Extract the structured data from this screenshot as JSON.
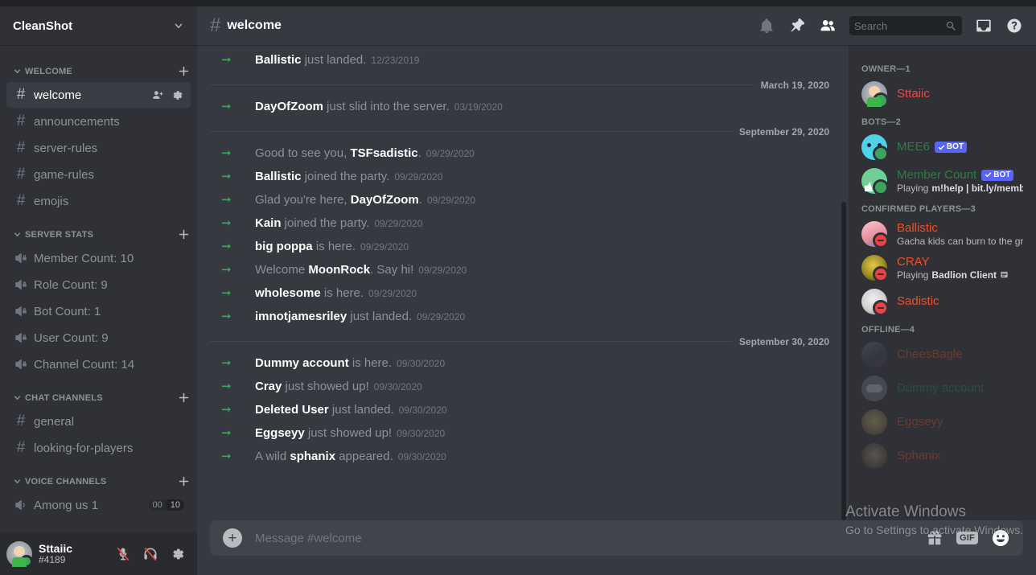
{
  "server": {
    "name": "CleanShot",
    "chevron_icon": "chevron-down-icon"
  },
  "sidebar": {
    "categories": [
      {
        "label": "WELCOME",
        "channels": [
          {
            "name": "welcome",
            "type": "text",
            "active": true,
            "actions": [
              "person-add-icon",
              "gear-icon"
            ]
          },
          {
            "name": "announcements",
            "type": "text",
            "active": false
          },
          {
            "name": "server-rules",
            "type": "text",
            "active": false
          },
          {
            "name": "game-rules",
            "type": "text",
            "active": false
          },
          {
            "name": "emojis",
            "type": "text",
            "active": false
          }
        ]
      },
      {
        "label": "SERVER STATS",
        "channels": [
          {
            "name": "Member Count: 10",
            "type": "voice-locked",
            "active": false
          },
          {
            "name": "Role Count: 9",
            "type": "voice-locked",
            "active": false
          },
          {
            "name": "Bot Count: 1",
            "type": "voice-locked",
            "active": false
          },
          {
            "name": "User Count: 9",
            "type": "voice-locked",
            "active": false
          },
          {
            "name": "Channel Count: 14",
            "type": "voice-locked",
            "active": false
          }
        ]
      },
      {
        "label": "CHAT CHANNELS",
        "channels": [
          {
            "name": "general",
            "type": "text",
            "active": false
          },
          {
            "name": "looking-for-players",
            "type": "text",
            "active": false
          }
        ]
      },
      {
        "label": "VOICE CHANNELS",
        "channels": [
          {
            "name": "Among us 1",
            "type": "voice",
            "active": false,
            "limit_current": "00",
            "limit_max": "10"
          }
        ]
      }
    ],
    "add_channel_icon": "plus-icon",
    "collapse_icon": "chevron-down-icon"
  },
  "user_panel": {
    "name": "Sttaiic",
    "tag": "#4189",
    "avatar": "av-sttaiic",
    "buttons": [
      {
        "name": "mute-button",
        "icon": "microphone-muted-icon"
      },
      {
        "name": "deafen-button",
        "icon": "headphones-deafened-icon"
      },
      {
        "name": "user-settings-button",
        "icon": "gear-icon"
      }
    ]
  },
  "header": {
    "channel_name": "welcome",
    "hash_icon": "hash-icon",
    "icons": [
      {
        "name": "notifications-button",
        "icon": "bell-icon"
      },
      {
        "name": "pinned-messages-button",
        "icon": "pin-icon"
      },
      {
        "name": "member-list-button",
        "icon": "members-icon"
      }
    ],
    "right_icons": [
      {
        "name": "inbox-button",
        "icon": "inbox-icon"
      },
      {
        "name": "help-button",
        "icon": "help-circle-icon"
      }
    ]
  },
  "search": {
    "placeholder": "Search",
    "value": "",
    "icon": "search-icon"
  },
  "messages": [
    {
      "kind": "system",
      "prefix": "",
      "user": "Ballistic",
      "suffix": " just landed.",
      "timestamp": "12/23/2019"
    },
    {
      "kind": "divider",
      "label": "March 19, 2020"
    },
    {
      "kind": "system",
      "prefix": "",
      "user": "DayOfZoom",
      "suffix": " just slid into the server.",
      "timestamp": "03/19/2020"
    },
    {
      "kind": "divider",
      "label": "September 29, 2020"
    },
    {
      "kind": "system",
      "prefix": "Good to see you, ",
      "user": "TSFsadistic",
      "suffix": ".",
      "timestamp": "09/29/2020"
    },
    {
      "kind": "system",
      "prefix": "",
      "user": "Ballistic",
      "suffix": " joined the party.",
      "timestamp": "09/29/2020"
    },
    {
      "kind": "system",
      "prefix": "Glad you're here, ",
      "user": "DayOfZoom",
      "suffix": ".",
      "timestamp": "09/29/2020"
    },
    {
      "kind": "system",
      "prefix": "",
      "user": "Kain",
      "suffix": " joined the party.",
      "timestamp": "09/29/2020"
    },
    {
      "kind": "system",
      "prefix": "",
      "user": "big poppa",
      "suffix": " is here.",
      "timestamp": "09/29/2020"
    },
    {
      "kind": "system",
      "prefix": "Welcome ",
      "user": "MoonRock",
      "suffix": ". Say hi!",
      "timestamp": "09/29/2020"
    },
    {
      "kind": "system",
      "prefix": "",
      "user": "wholesome",
      "suffix": " is here.",
      "timestamp": "09/29/2020"
    },
    {
      "kind": "system",
      "prefix": "",
      "user": "imnotjamesriley",
      "suffix": " just landed.",
      "timestamp": "09/29/2020"
    },
    {
      "kind": "divider",
      "label": "September 30, 2020"
    },
    {
      "kind": "system",
      "prefix": "",
      "user": "Dummy account",
      "suffix": " is here.",
      "timestamp": "09/30/2020"
    },
    {
      "kind": "system",
      "prefix": "",
      "user": "Cray",
      "suffix": " just showed up!",
      "timestamp": "09/30/2020"
    },
    {
      "kind": "system",
      "prefix": "",
      "user": "Deleted User",
      "suffix": " just landed.",
      "timestamp": "09/30/2020"
    },
    {
      "kind": "system",
      "prefix": "",
      "user": "Eggseyy",
      "suffix": " just showed up!",
      "timestamp": "09/30/2020"
    },
    {
      "kind": "system",
      "prefix": "A wild ",
      "user": "sphanix",
      "suffix": " appeared.",
      "timestamp": "09/30/2020"
    }
  ],
  "composer": {
    "placeholder": "Message #welcome",
    "value": "",
    "add_icon": "plus-circle-icon",
    "gift_icon": "gift-icon",
    "gif_label": "GIF",
    "emoji_icon": "emoji-icon"
  },
  "member_list": {
    "groups": [
      {
        "label": "OWNER—1",
        "members": [
          {
            "name": "Sttaiic",
            "color": "#f04747",
            "avatar": "av-sttaiic",
            "status": "online",
            "sub": "",
            "bot": false
          }
        ]
      },
      {
        "label": "BOTS—2",
        "members": [
          {
            "name": "MEE6",
            "color": "#2d7d46",
            "avatar": "av-mee6",
            "status": "online",
            "sub": "",
            "bot": true,
            "bot_label": "BOT"
          },
          {
            "name": "Member Count",
            "color": "#2d7d46",
            "avatar": "av-mc",
            "status": "online",
            "sub": "Playing m!help | bit.ly/membe…",
            "sub_bold": "m!help | bit.ly/membe…",
            "sub_prefix": "Playing ",
            "bot": true,
            "bot_label": "BOT"
          }
        ]
      },
      {
        "label": "CONFIRMED PLAYERS—3",
        "members": [
          {
            "name": "Ballistic",
            "color": "#f04f28",
            "avatar": "av-ballistic",
            "status": "dnd",
            "sub": "Gacha kids can burn to the gro…",
            "bot": false
          },
          {
            "name": "CRAY",
            "color": "#f04f28",
            "avatar": "av-cray",
            "status": "dnd",
            "sub_prefix": "Playing ",
            "sub_bold": "Badlion Client",
            "sub": "Playing Badlion Client",
            "bot": false
          },
          {
            "name": "Sadistic",
            "color": "#f04f28",
            "avatar": "av-sadistic",
            "status": "dnd",
            "sub": "",
            "bot": false
          }
        ]
      },
      {
        "label": "OFFLINE—4",
        "offline": true,
        "members": [
          {
            "name": "CheesBagle",
            "color": "#f04f28",
            "avatar": "av-chees",
            "status": "none",
            "sub": "",
            "bot": false
          },
          {
            "name": "Dummy account",
            "color": "#1f8b6e",
            "avatar": "av-dummy",
            "status": "none",
            "sub": "",
            "bot": false
          },
          {
            "name": "Eggseyy",
            "color": "#f04f28",
            "avatar": "av-eggs",
            "status": "none",
            "sub": "",
            "bot": false
          },
          {
            "name": "Sphanix",
            "color": "#f04f28",
            "avatar": "av-sphanix",
            "status": "none",
            "sub": "",
            "bot": false
          }
        ]
      }
    ]
  },
  "watermark": {
    "line1": "Activate Windows",
    "line2": "Go to Settings to activate Windows."
  },
  "scrollbar": {
    "thumb_top_pct": 33,
    "thumb_height_pct": 67
  },
  "colors": {
    "sidebar_bg": "#2f3136",
    "chat_bg": "#36393f",
    "accent_green": "#3ba55d",
    "bot_badge": "#5865f2",
    "online": "#3ba55d",
    "dnd": "#ed4245"
  }
}
